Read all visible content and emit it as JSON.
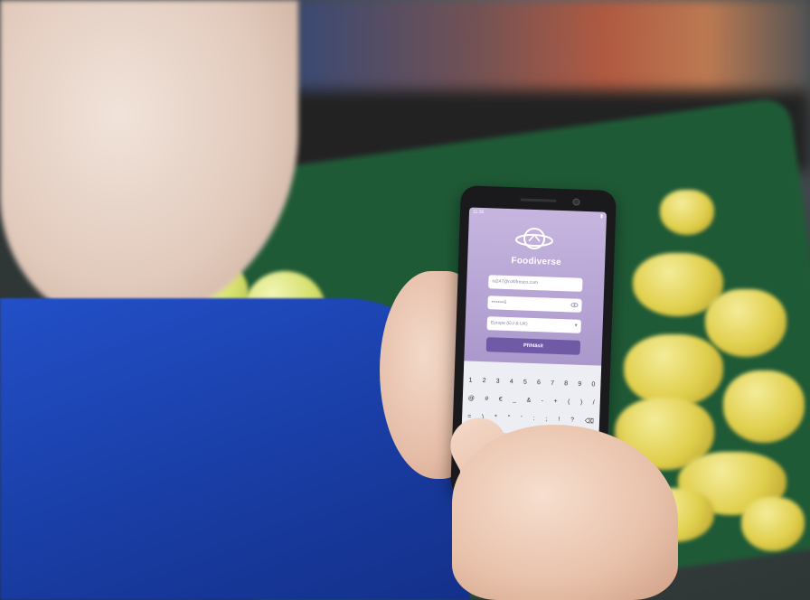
{
  "app": {
    "brand": "Foodiverse",
    "email_value": "ra247@rohlfresco.com",
    "password_value": "••••••••5",
    "region_value": "Europe (EU & UK)",
    "login_label": "Přihlásit",
    "status_time": "11:26"
  },
  "keyboard": {
    "row1": [
      "1",
      "2",
      "3",
      "4",
      "5",
      "6",
      "7",
      "8",
      "9",
      "0"
    ],
    "row2": [
      "@",
      "#",
      "€",
      "_",
      "&",
      "-",
      "+",
      "(",
      ")",
      "/"
    ],
    "row3": [
      "=",
      "\\",
      "*",
      "\"",
      "'",
      ":",
      ";",
      "!",
      "?",
      "⌫"
    ],
    "enter_label": "✓"
  },
  "colors": {
    "screen_purple": "#a996cb",
    "button_purple": "#6f5aa6",
    "jacket_blue": "#1a3fa8",
    "crate_green": "#1f5a36"
  },
  "icons": [
    "planet-logo-icon",
    "eye-icon",
    "chevron-down-icon",
    "backspace-icon"
  ]
}
